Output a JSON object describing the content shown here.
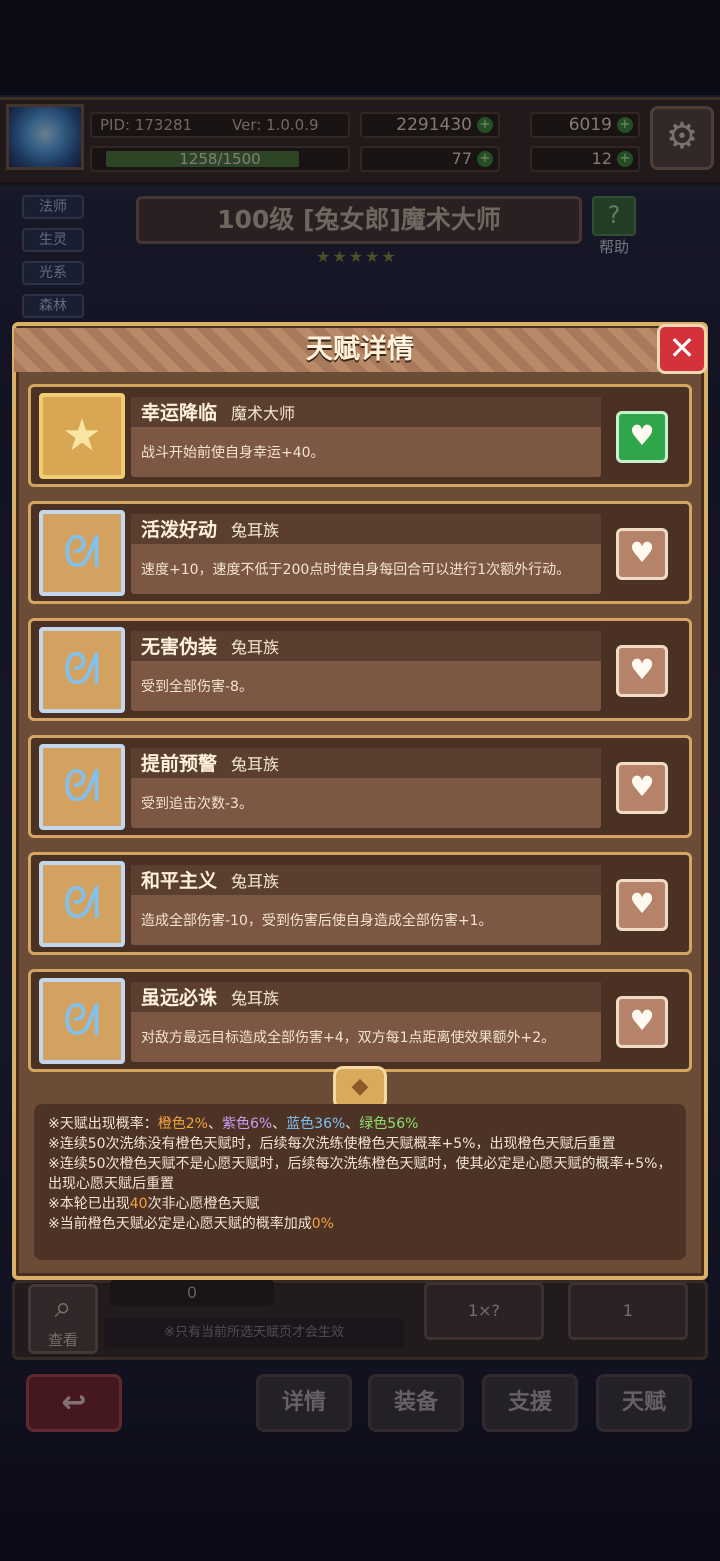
{
  "hud": {
    "pid_label": "PID: 173281",
    "version": "Ver: 1.0.0.9",
    "gold": "2291430",
    "gems": "6019",
    "xp": "1258/1500",
    "xp_progress": 0.839,
    "clover": "77",
    "keys": "12",
    "plus": "+"
  },
  "side_tags": [
    "法师",
    "生灵",
    "光系",
    "森林"
  ],
  "hero": {
    "title": "100级 [兔女郎]魔术大师",
    "stars": "★★★★★",
    "help_label": "帮助",
    "help_icon": "?"
  },
  "modal": {
    "title": "天赋详情",
    "close": "✕",
    "talents": [
      {
        "name": "幸运降临",
        "tag": "魔术大师",
        "desc": "战斗开始前使自身幸运+40。",
        "icon": "star-icon",
        "wish": true
      },
      {
        "name": "活泼好动",
        "tag": "兔耳族",
        "desc": "速度+10，速度不低于200点时使自身每回合可以进行1次额外行动。",
        "icon": "bunny-icon",
        "wish": false
      },
      {
        "name": "无害伪装",
        "tag": "兔耳族",
        "desc": "受到全部伤害-8。",
        "icon": "bunny-icon",
        "wish": false
      },
      {
        "name": "提前预警",
        "tag": "兔耳族",
        "desc": "受到追击次数-3。",
        "icon": "bunny-icon",
        "wish": false
      },
      {
        "name": "和平主义",
        "tag": "兔耳族",
        "desc": "造成全部伤害-10，受到伤害后使自身造成全部伤害+1。",
        "icon": "bunny-icon",
        "wish": false
      },
      {
        "name": "虽远必诛",
        "tag": "兔耳族",
        "desc": "对敌方最远目标造成全部伤害+4，双方每1点距离使效果额外+2。",
        "icon": "bunny-icon",
        "wish": false
      }
    ],
    "info": {
      "line1_prefix": "※天赋出现概率：",
      "orange": "橙色2%",
      "sep1": "、",
      "purple": "紫色6%",
      "sep2": "、",
      "blue": "蓝色36%",
      "sep3": "、",
      "green": "绿色56%",
      "line2": "※连续50次洗练没有橙色天赋时，后续每次洗练使橙色天赋概率+5%，出现橙色天赋后重置",
      "line3": "※连续50次橙色天赋不是心愿天赋时，后续每次洗练橙色天赋时，使其必定是心愿天赋的概率+5%，出现心愿天赋后重置",
      "line4_prefix": "※本轮已出现",
      "line4_count": "40",
      "line4_suffix": "次非心愿橙色天赋",
      "line5_prefix": "※当前橙色天赋必定是心愿天赋的概率加成",
      "line5_value": "0%"
    }
  },
  "bottom": {
    "count": "0",
    "view_label": "查看",
    "note": "※只有当前所选天赋页才会生效",
    "auto_wash": "1×?",
    "talent_wash": "1",
    "nav": [
      "详情",
      "装备",
      "支援",
      "天赋"
    ]
  }
}
